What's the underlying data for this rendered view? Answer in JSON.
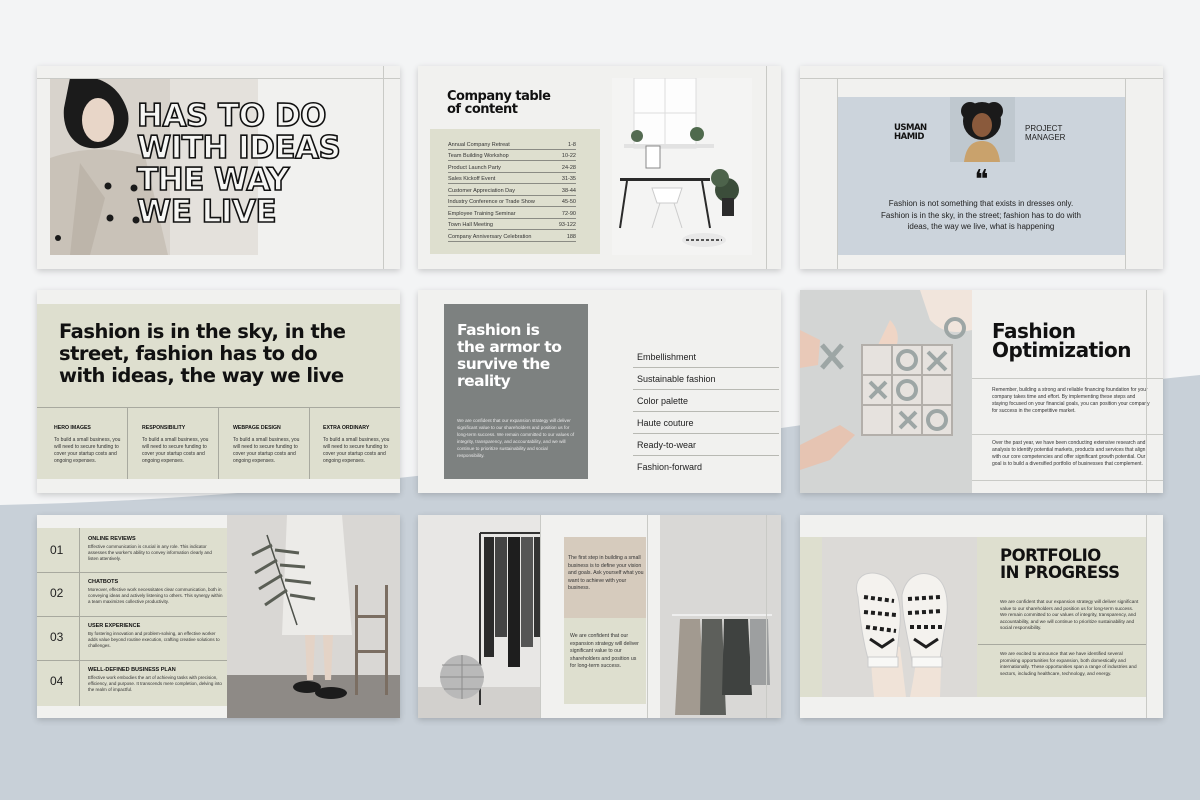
{
  "colors": {
    "sage": "#dedfcf",
    "gray_panel": "#7d8180",
    "blue_gray": "#ccd4dc",
    "beige": "#d6cbbd"
  },
  "slide1": {
    "headline": [
      "HAS TO DO",
      "WITH IDEAS",
      "THE WAY",
      "WE LIVE"
    ]
  },
  "slide2": {
    "title": [
      "Company table",
      "of content"
    ],
    "rows": [
      {
        "label": "Annual Company Retreat",
        "pages": "1-8"
      },
      {
        "label": "Team Building Workshop",
        "pages": "10-22"
      },
      {
        "label": "Product Launch Party",
        "pages": "24-28"
      },
      {
        "label": "Sales Kickoff Event",
        "pages": "31-35"
      },
      {
        "label": "Customer Appreciation Day",
        "pages": "38-44"
      },
      {
        "label": "Industry Conference or Trade Show",
        "pages": "45-50"
      },
      {
        "label": "Employee Training Seminar",
        "pages": "72-90"
      },
      {
        "label": "Town Hall Meeting",
        "pages": "93-122"
      },
      {
        "label": "Company Anniversary Celebration",
        "pages": "188"
      }
    ]
  },
  "slide3": {
    "name": [
      "USMAN",
      "HAMID"
    ],
    "role": [
      "PROJECT",
      "MANAGER"
    ],
    "quote_mark": "❝",
    "quote": [
      "Fashion is not something that exists in dresses only.",
      "Fashion is in the sky, in the street; fashion has to do with",
      "ideas, the way we live, what is happening"
    ]
  },
  "slide4": {
    "headline": [
      "Fashion is in the sky, in the",
      "street, fashion has to do",
      "with ideas, the way we live"
    ],
    "columns": [
      {
        "title": "HERO IMAGES",
        "body": "To build a small business, you will need to secure funding to cover your startup costs and ongoing expenses."
      },
      {
        "title": "RESPONSIBILITY",
        "body": "To build a small business, you will need to secure funding to cover your startup costs and ongoing expenses."
      },
      {
        "title": "WEBPAGE DESIGN",
        "body": "To build a small business, you will need to secure funding to cover your startup costs and ongoing expenses."
      },
      {
        "title": "EXTRA ORDINARY",
        "body": "To build a small business, you will need to secure funding to cover your startup costs and ongoing expenses."
      }
    ]
  },
  "slide5": {
    "title": [
      "Fashion is",
      "the armor to",
      "survive the",
      "reality"
    ],
    "body": "We are confident that our expansion strategy will deliver significant value to our shareholders and position us for long-term success. We remain committed to our values of integrity, transparency, and accountability, and we will continue to prioritize sustainability and social responsibility.",
    "menu": [
      "Embellishment",
      "Sustainable fashion",
      "Color palette",
      "Haute couture",
      "Ready-to-wear",
      "Fashion-forward"
    ]
  },
  "slide6": {
    "title": [
      "Fashion",
      "Optimization"
    ],
    "p1": "Remember, building a strong and reliable financing foundation for your company takes time and effort. By implementing these steps and staying focused on your financial goals, you can position your company for success in the competitive market.",
    "p2": "Over the past year, we have been conducting extensive research and analysis to identify potential markets, products and services that align with our core competencies and offer significant growth potential. Our goal is to build a diversified portfolio of businesses that complement."
  },
  "slide7": {
    "items": [
      {
        "num": "01",
        "title": "ONLINE REVIEWS",
        "body": "Effective communication is crucial in any role. This indicator assesses the worker's ability to convey information clearly and listen attentively."
      },
      {
        "num": "02",
        "title": "CHATBOTS",
        "body": "Moreover, effective work necessitates clear communication, both in conveying ideas and actively listening to others. This synergy within a team maximizes collective productivity."
      },
      {
        "num": "03",
        "title": "USER EXPERIENCE",
        "body": "By fostering innovation and problem-solving, an effective worker adds value beyond routine execution, crafting creative solutions to challenges."
      },
      {
        "num": "04",
        "title": "WELL-DEFINED BUSINESS PLAN",
        "body": "Effective work embodies the art of achieving tasks with precision, efficiency, and purpose. It transcends mere completion, delving into the realm of impactful."
      }
    ]
  },
  "slide8": {
    "p1": "The first step in building a small business is to define your vision and goals. Ask yourself what you want to achieve with your business.",
    "p2": "We are confident that our expansion strategy will deliver significant value to our shareholders and position us for long-term success."
  },
  "slide9": {
    "title": [
      "PORTFOLIO",
      "IN PROGRESS"
    ],
    "p1": "We are confident that our expansion strategy will deliver significant value to our shareholders and position us for long-term success. We remain committed to our values of integrity, transparency, and accountability, and we will continue to prioritize sustainability and social responsibility.",
    "p2": "We are excited to announce that we have identified several promising opportunities for expansion, both domestically and internationally. These opportunities span a range of industries and sectors, including healthcare, technology, and energy."
  }
}
